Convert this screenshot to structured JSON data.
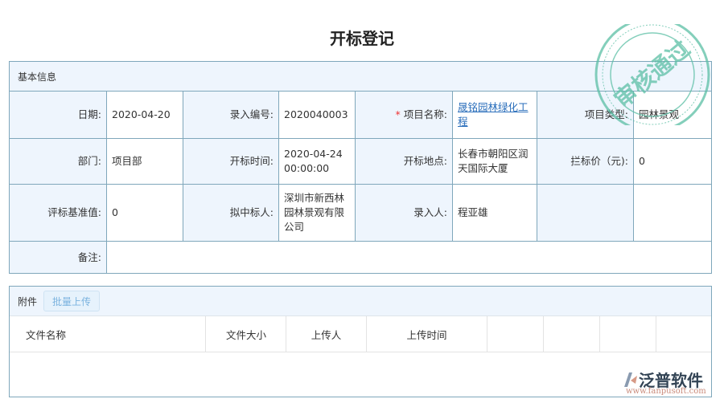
{
  "title": "开标登记",
  "basic": {
    "header": "基本信息",
    "date_label": "日期:",
    "date": "2020-04-20",
    "code_label": "录入编号:",
    "code": "2020040003",
    "project_label": "项目名称:",
    "project": "晟铭园林绿化工程",
    "type_label": "项目类型:",
    "type": "园林景观",
    "dept_label": "部门:",
    "dept": "项目部",
    "open_time_label": "开标时间:",
    "open_time": "2020-04-24 00:00:00",
    "place_label": "开标地点:",
    "place": "长春市朝阳区润天国际大厦",
    "price_label": "拦标价（元):",
    "price": "0",
    "base_label": "评标基准值:",
    "base": "0",
    "winner_label": "拟中标人:",
    "winner": "深圳市新西林园林景观有限公司",
    "entry_label": "录入人:",
    "entry": "程亚雄",
    "remark_label": "备注:"
  },
  "attach": {
    "header": "附件",
    "upload": "批量上传",
    "columns": [
      "文件名称",
      "文件大小",
      "上传人",
      "上传时间"
    ]
  },
  "stamp": "审核通过",
  "logo": {
    "name": "泛普软件",
    "url": "www.fanpusoft.com"
  },
  "colors": {
    "border": "#7fa7bb",
    "label_bg": "#eef5fd",
    "stamp": "#5cbfa5"
  }
}
